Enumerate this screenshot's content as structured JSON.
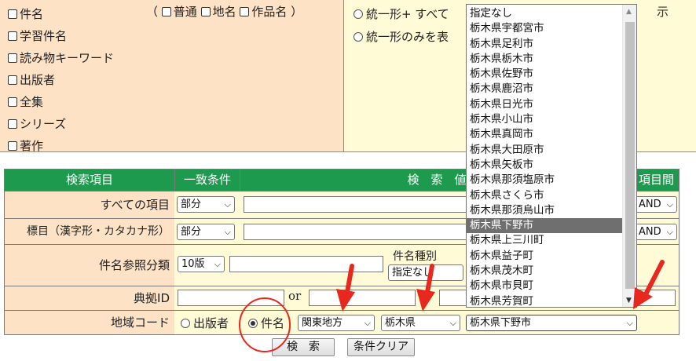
{
  "top_panel": {
    "left_items": [
      "件名",
      "学習件名",
      "読み物キーワード",
      "出版者",
      "全集",
      "シリーズ",
      "著作"
    ],
    "subject_paren_open": "（",
    "subject_options": [
      "普通",
      "地名",
      "作品名"
    ],
    "subject_paren_close": "）",
    "right_radio_1": "統一形+ すべて",
    "right_radio_2": "統一形のみを表",
    "right_radio_1_tail": "示"
  },
  "table": {
    "headers": [
      "検索項目",
      "一致条件",
      "検　索　値",
      "項目間"
    ],
    "rows": {
      "all_items": {
        "label": "すべての項目",
        "match": "部分",
        "op": "AND"
      },
      "heading": {
        "label": "標目（漢字形・カタカナ形）",
        "match": "部分",
        "op": "AND"
      },
      "subject_ref": {
        "label": "件名参照分類",
        "edition": "10版",
        "type_label": "件名種別",
        "type_value": "指定なし"
      },
      "source_id": {
        "label": "典拠ID",
        "or1": "or"
      },
      "region": {
        "label": "地域コード",
        "radio_publisher": "出版者",
        "radio_subject": "件名",
        "region_value": "関東地方",
        "pref_value": "栃木県",
        "city_value": "栃木県下野市"
      }
    }
  },
  "buttons": {
    "search": "検　索",
    "clear": "条件クリア"
  },
  "dropdown": {
    "options": [
      "指定なし",
      "栃木県宇都宮市",
      "栃木県足利市",
      "栃木県栃木市",
      "栃木県佐野市",
      "栃木県鹿沼市",
      "栃木県日光市",
      "栃木県小山市",
      "栃木県真岡市",
      "栃木県大田原市",
      "栃木県矢板市",
      "栃木県那須塩原市",
      "栃木県さくら市",
      "栃木県那須烏山市",
      "栃木県下野市",
      "栃木県上三川町",
      "栃木県益子町",
      "栃木県茂木町",
      "栃木県市貝町",
      "栃木県芳賀町"
    ],
    "selected": "栃木県下野市"
  },
  "colors": {
    "peach": "#fde2c6",
    "cream": "#fffbd7",
    "header_green": "#1e9a4e",
    "selected_gray": "#6f6f6f",
    "arrow_red": "#e8281e"
  }
}
